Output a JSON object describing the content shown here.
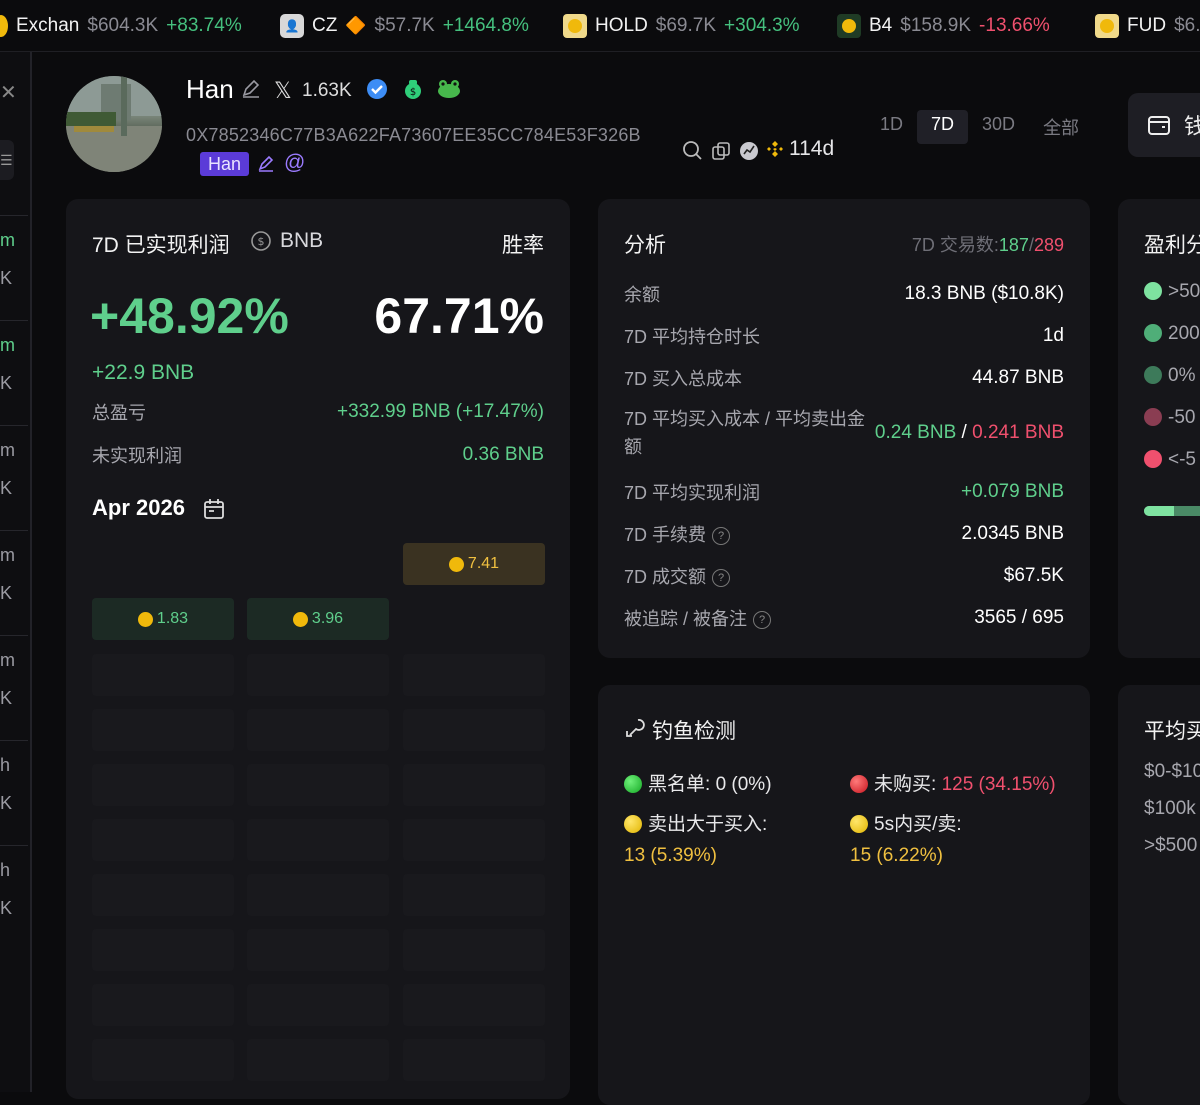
{
  "ticker": [
    {
      "name": "Exchan",
      "price": "$604.3K",
      "change": "+83.74%",
      "dir": "up",
      "icon": "coin-icon"
    },
    {
      "name": "CZ",
      "emoji": "🔶",
      "price": "$57.7K",
      "change": "+1464.8%",
      "dir": "up",
      "icon": "avatar-icon"
    },
    {
      "name": "HOLD",
      "price": "$69.7K",
      "change": "+304.3%",
      "dir": "up",
      "icon": "token-icon"
    },
    {
      "name": "B4",
      "price": "$158.9K",
      "change": "-13.66%",
      "dir": "dn",
      "icon": "token-icon"
    },
    {
      "name": "FUD",
      "price": "$6.",
      "change": "",
      "dir": "up",
      "icon": "token-icon"
    }
  ],
  "left_strip": [
    "m",
    "K",
    "m",
    "K",
    "m",
    "K",
    "m",
    "K",
    "m",
    "K",
    "h",
    "K",
    "h",
    "K"
  ],
  "profile": {
    "name": "Han",
    "x_followers": "1.63K",
    "address": "0X7852346C77B3A622FA73607EE35CC784E53F326B",
    "tag": "Han",
    "age": "114d"
  },
  "timeframes": [
    "1D",
    "7D",
    "30D",
    "全部"
  ],
  "active_timeframe": "7D",
  "pnl_card": {
    "title": "7D 已实现利润",
    "currency": "BNB",
    "winrate_label": "胜率",
    "pnl_pct": "+48.92%",
    "winrate": "67.71%",
    "pnl_bnb": "+22.9 BNB",
    "total_label": "总盈亏",
    "total_value": "+332.99 BNB (+17.47%)",
    "unrealized_label": "未实现利润",
    "unrealized_value": "0.36 BNB",
    "month": "Apr 2026",
    "calendar": [
      {
        "value": "1.83",
        "tone": "green"
      },
      {
        "value": "3.96",
        "tone": "green"
      },
      {
        "value": "7.41",
        "tone": "gold"
      }
    ]
  },
  "analysis_card": {
    "title": "分析",
    "trades_label": "7D 交易数:",
    "trades_buy": "187",
    "trades_sep": "/",
    "trades_sell": "289",
    "rows": [
      {
        "label": "余额",
        "value": "18.3 BNB ($10.8K)",
        "tone": "white",
        "help": false
      },
      {
        "label": "7D 平均持仓时长",
        "value": "1d",
        "tone": "white",
        "help": false
      },
      {
        "label": "7D 买入总成本",
        "value": "44.87 BNB",
        "tone": "white",
        "help": false
      },
      {
        "label": "7D 平均买入成本 / 平均卖出金额",
        "value": "",
        "value_buy": "0.24 BNB",
        "value_sep": "/",
        "value_sell": "0.241 BNB",
        "tone": "mixed",
        "help": false
      },
      {
        "label": "7D 平均实现利润",
        "value": "+0.079 BNB",
        "tone": "green",
        "help": false
      },
      {
        "label": "7D 手续费",
        "value": "2.0345 BNB",
        "tone": "white",
        "help": true
      },
      {
        "label": "7D 成交额",
        "value": "$67.5K",
        "tone": "white",
        "help": true
      },
      {
        "label": "被追踪 / 被备注",
        "value": "3565 / 695",
        "tone": "white",
        "help": true
      }
    ]
  },
  "phishing_card": {
    "title": "钓鱼检测",
    "blacklist_label": "黑名单:",
    "blacklist_value": "0 (0%)",
    "not_bought_label": "未购买:",
    "not_bought_value": "125 (34.15%)",
    "sell_gt_buy_label": "卖出大于买入:",
    "sell_gt_buy_value": "13 (5.39%)",
    "fast_trade_label": "5s内买/卖:",
    "fast_trade_value": "15 (6.22%)"
  },
  "profit_dist_card": {
    "title": "盈利分",
    "rows": [
      ">50",
      "200",
      "0%",
      "-50",
      "<-5"
    ],
    "colors": [
      "#7ee2a0",
      "#4fae78",
      "#3d7a5a",
      "#8a3d52",
      "#f0506e"
    ]
  },
  "avg_buy_card": {
    "title": "平均买",
    "rows": [
      "$0-$10",
      "$100k",
      ">$500"
    ]
  },
  "wallet_button_label": "钱"
}
